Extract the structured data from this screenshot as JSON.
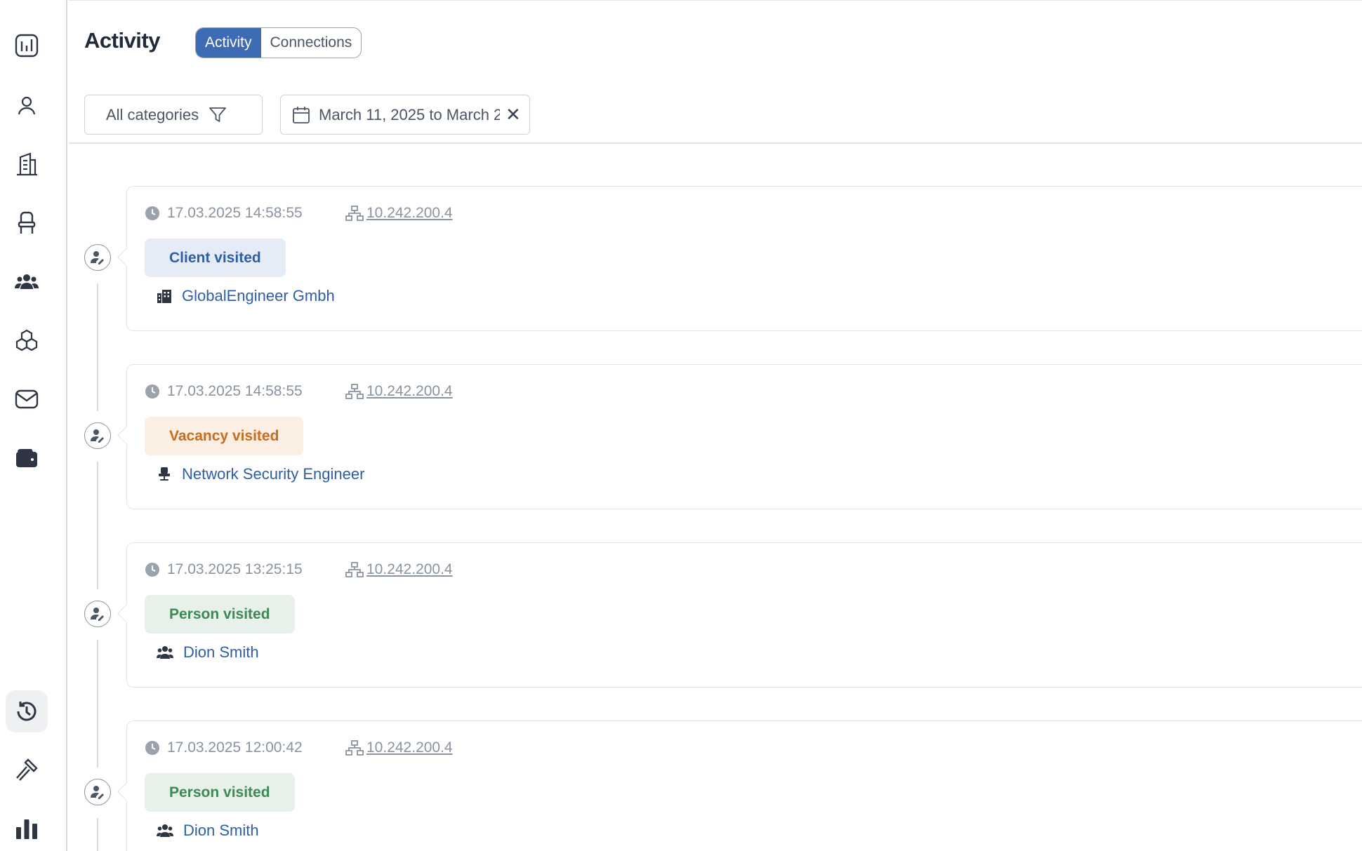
{
  "sidebar": {
    "items": [
      {
        "icon": "dashboard-icon",
        "active": false
      },
      {
        "icon": "person-icon",
        "active": false
      },
      {
        "icon": "company-building-icon",
        "active": false
      },
      {
        "icon": "chair-vacancy-icon",
        "active": false
      },
      {
        "icon": "people-group-icon",
        "active": false
      },
      {
        "icon": "cubes-icon",
        "active": false
      },
      {
        "icon": "mail-icon",
        "active": false
      },
      {
        "icon": "wallet-icon",
        "active": false
      },
      {
        "icon": "history-icon",
        "active": true
      },
      {
        "icon": "tools-icon",
        "active": false
      },
      {
        "icon": "bar-chart-icon",
        "active": false
      }
    ]
  },
  "header": {
    "title": "Activity",
    "tabs": [
      "Activity",
      "Connections"
    ],
    "active_tab": "Activity"
  },
  "filters": {
    "category_label": "All categories",
    "date_range": "March 11, 2025 to March 2"
  },
  "colors": {
    "accent": "#3d6bb4",
    "link": "#2f5ea4",
    "client_badge": "#e6ecf5",
    "vacancy_badge": "#fbeee3",
    "person_badge": "#e7f1ea"
  },
  "activities": [
    {
      "time": "17.03.2025 14:58:55",
      "ip": "10.242.200.4",
      "type": "Client visited",
      "target": "GlobalEngineer Gmbh",
      "target_icon": "building-icon"
    },
    {
      "time": "17.03.2025 14:58:55",
      "ip": "10.242.200.4",
      "type": "Vacancy visited",
      "target": "Network Security Engineer",
      "target_icon": "chair-icon"
    },
    {
      "time": "17.03.2025 13:25:15",
      "ip": "10.242.200.4",
      "type": "Person visited",
      "target": "Dion Smith",
      "target_icon": "people-icon"
    },
    {
      "time": "17.03.2025 12:00:42",
      "ip": "10.242.200.4",
      "type": "Person visited",
      "target": "Dion Smith",
      "target_icon": "people-icon"
    }
  ]
}
